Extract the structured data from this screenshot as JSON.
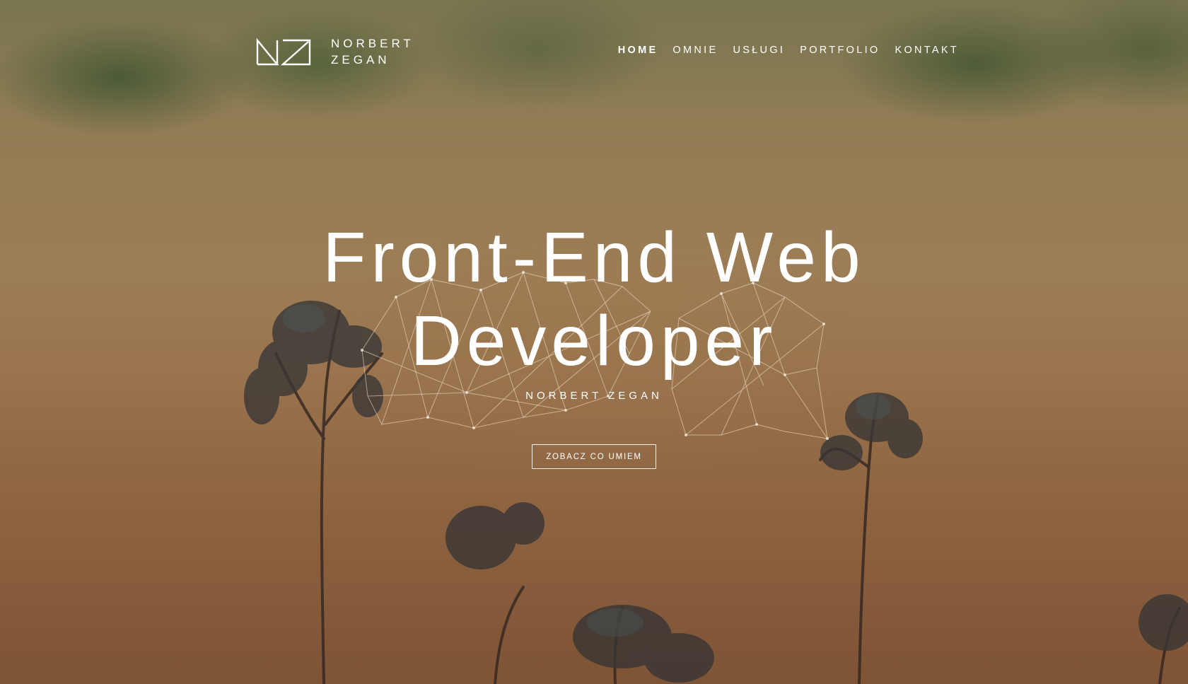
{
  "brand": {
    "line1": "NORBERT",
    "line2": "ZEGAN",
    "logo_icon": "nz-monogram-icon"
  },
  "nav": {
    "items": [
      {
        "label": "HOME",
        "active": true
      },
      {
        "label": "OMNIE",
        "active": false
      },
      {
        "label": "USŁUGI",
        "active": false
      },
      {
        "label": "PORTFOLIO",
        "active": false
      },
      {
        "label": "KONTAKT",
        "active": false
      }
    ]
  },
  "hero": {
    "title_line1": "Front-End Web",
    "title_line2": "Developer",
    "subtitle": "NORBERT ZEGAN",
    "cta_label": "ZOBACZ CO UMIEM",
    "decoration_icon": "polygon-network-icon",
    "background_image": "blurred-wheat-field-photo"
  },
  "colors": {
    "text": "#ffffff",
    "background_tone": "#a27a52"
  }
}
